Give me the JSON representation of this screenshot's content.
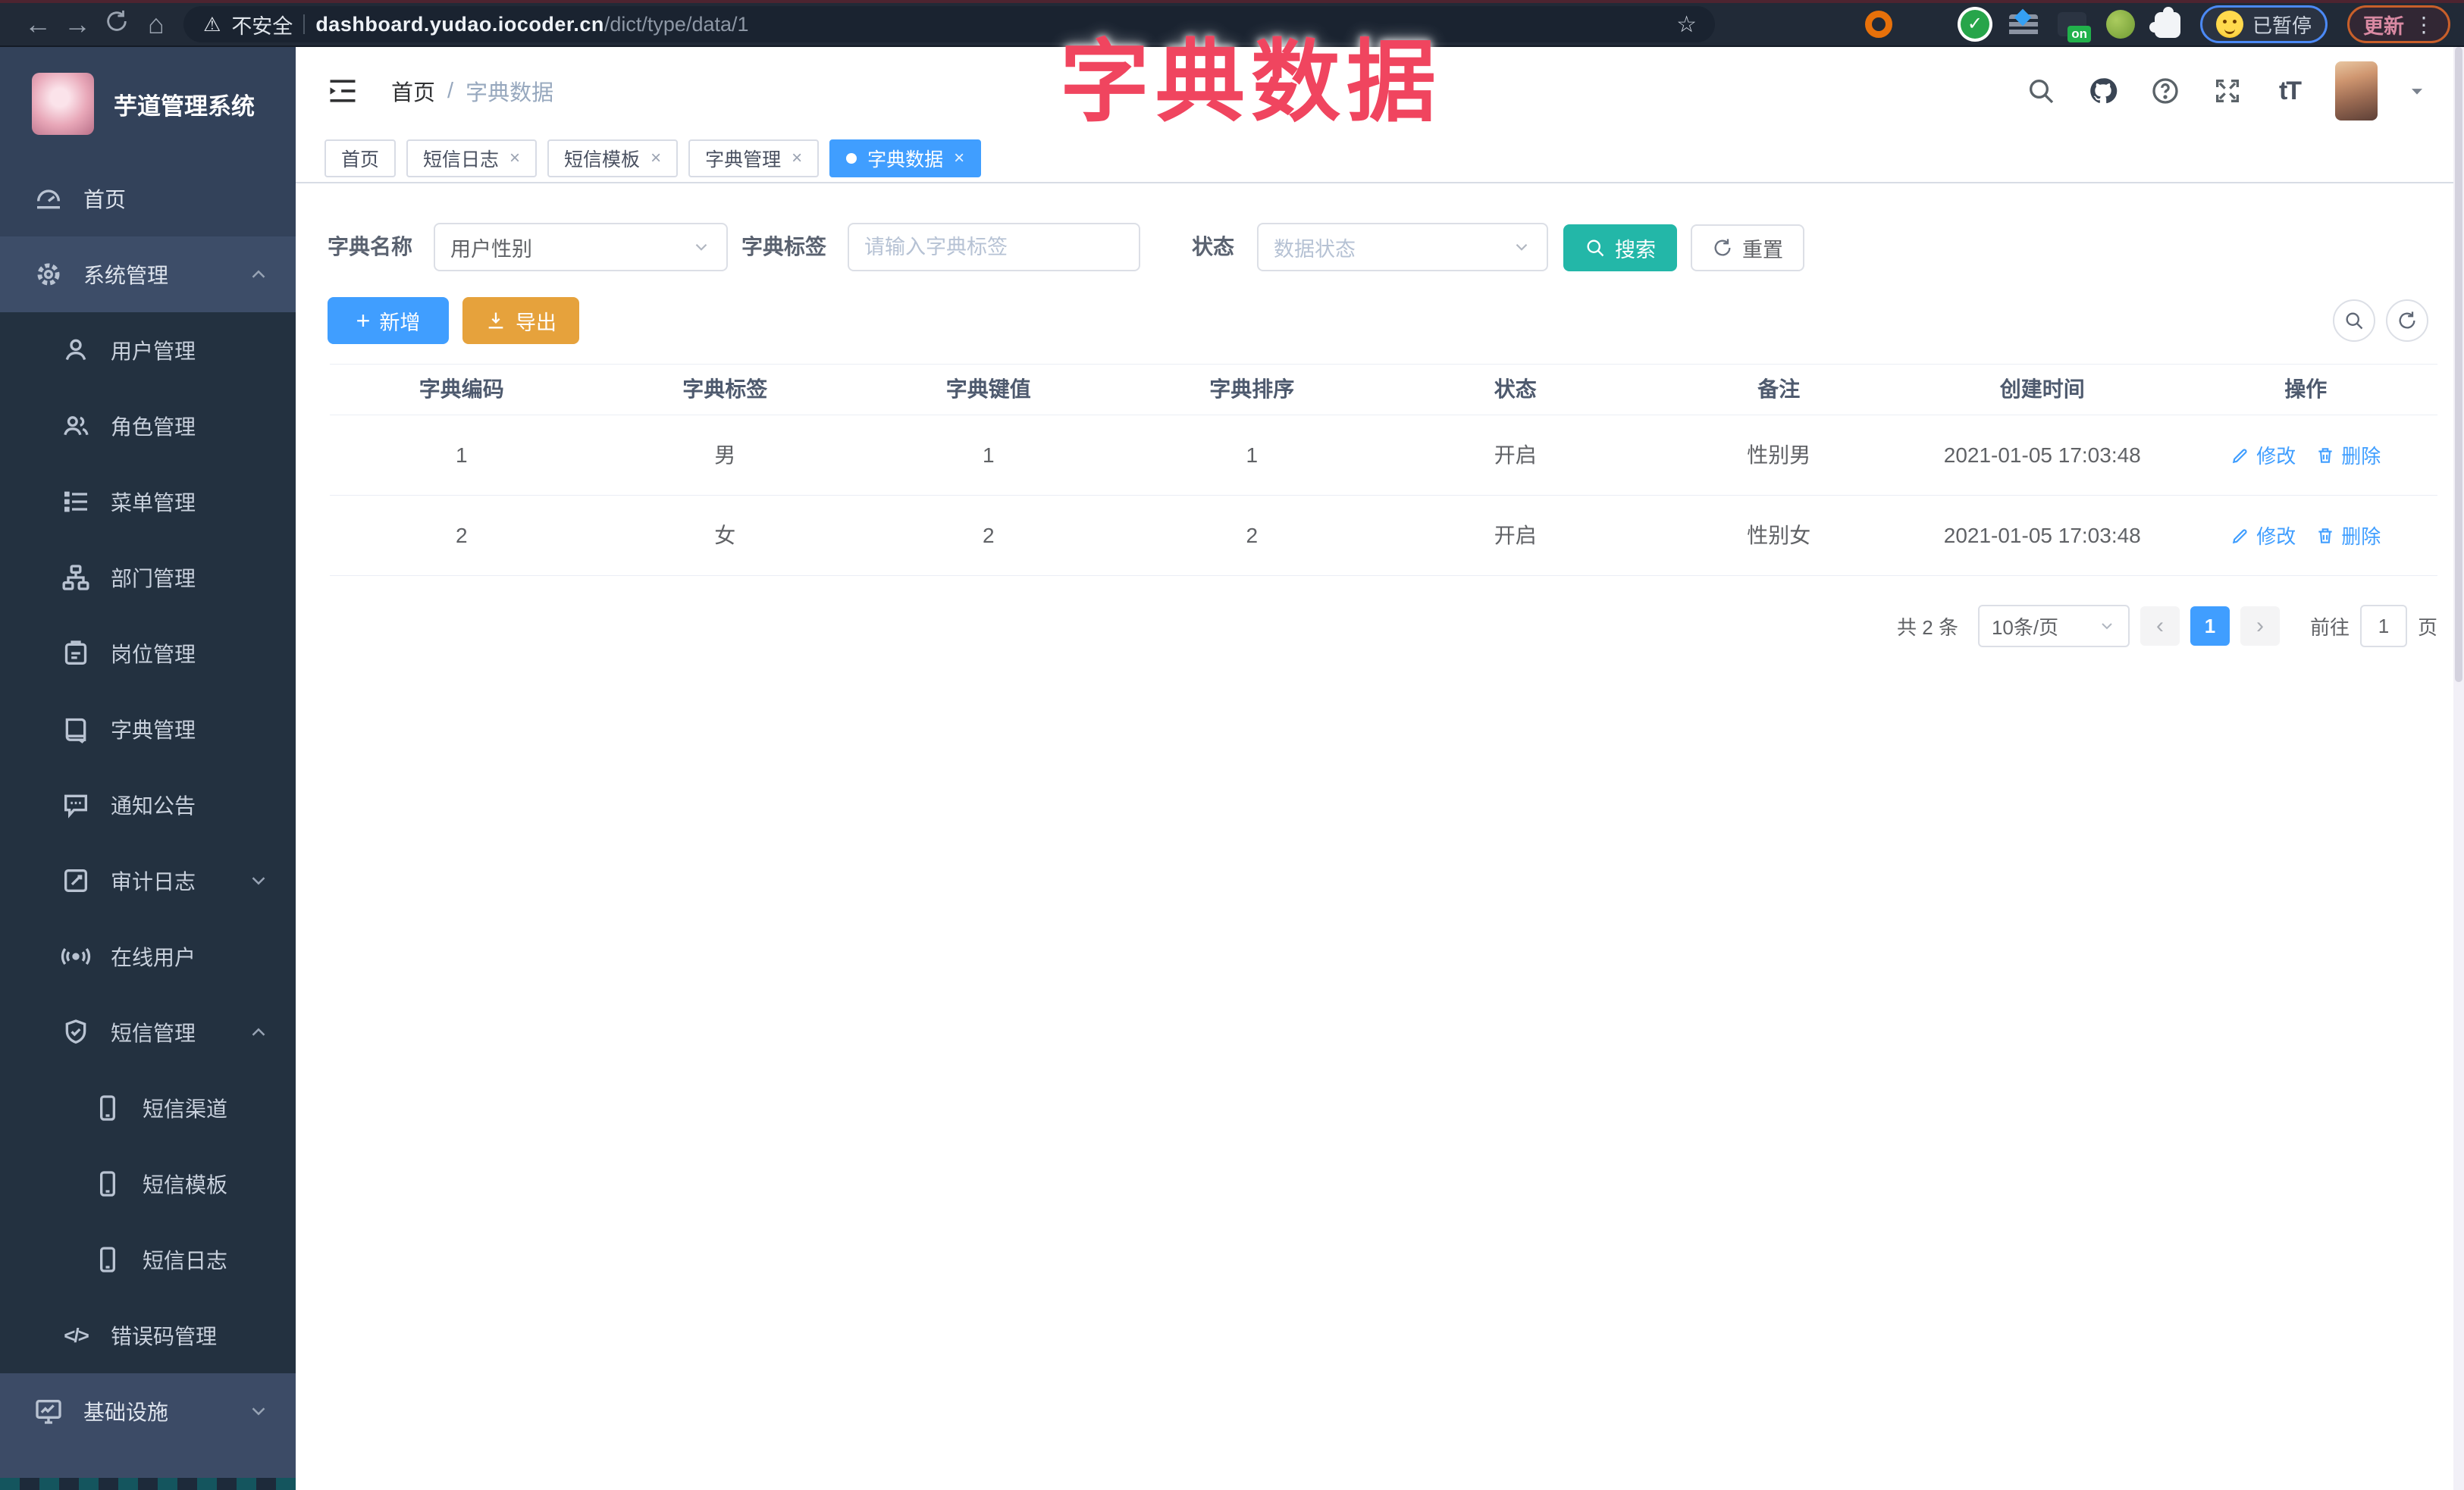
{
  "annotation": {
    "title": "字典数据"
  },
  "browser": {
    "back": "←",
    "forward": "→",
    "home_icon": "⌂",
    "warning": "⚠",
    "not_secure": "不安全",
    "url_host": "dashboard.yudao.iocoder.cn",
    "url_path": "/dict/type/data/1",
    "star": "☆",
    "ext_check": "✓",
    "ext_on_badge": "on",
    "profile_status": "已暂停",
    "update_label": "更新",
    "kebab": "⋮"
  },
  "sidebar": {
    "app_title": "芋道管理系统",
    "code_glyph": "</>",
    "items": [
      {
        "label": "首页"
      },
      {
        "label": "系统管理"
      },
      {
        "label": "用户管理"
      },
      {
        "label": "角色管理"
      },
      {
        "label": "菜单管理"
      },
      {
        "label": "部门管理"
      },
      {
        "label": "岗位管理"
      },
      {
        "label": "字典管理"
      },
      {
        "label": "通知公告"
      },
      {
        "label": "审计日志"
      },
      {
        "label": "在线用户"
      },
      {
        "label": "短信管理"
      },
      {
        "label": "短信渠道"
      },
      {
        "label": "短信模板"
      },
      {
        "label": "短信日志"
      },
      {
        "label": "错误码管理"
      },
      {
        "label": "基础设施"
      }
    ]
  },
  "header": {
    "breadcrumb_home": "首页",
    "breadcrumb_sep": "/",
    "breadcrumb_current": "字典数据",
    "font_icon": "tT"
  },
  "tabs": {
    "close": "×",
    "items": [
      {
        "label": "首页"
      },
      {
        "label": "短信日志"
      },
      {
        "label": "短信模板"
      },
      {
        "label": "字典管理"
      },
      {
        "label": "字典数据"
      }
    ]
  },
  "filters": {
    "name_label": "字典名称",
    "name_value": "用户性别",
    "tag_label": "字典标签",
    "tag_placeholder": "请输入字典标签",
    "status_label": "状态",
    "status_placeholder": "数据状态",
    "search_label": "搜索",
    "reset_label": "重置"
  },
  "toolbar": {
    "add_label": "新增",
    "export_label": "导出",
    "plus": "+"
  },
  "table": {
    "columns": [
      "字典编码",
      "字典标签",
      "字典键值",
      "字典排序",
      "状态",
      "备注",
      "创建时间",
      "操作"
    ],
    "rows": [
      {
        "code": "1",
        "label": "男",
        "value": "1",
        "sort": "1",
        "status": "开启",
        "remark": "性别男",
        "created": "2021-01-05 17:03:48",
        "edit": "修改",
        "del": "删除"
      },
      {
        "code": "2",
        "label": "女",
        "value": "2",
        "sort": "2",
        "status": "开启",
        "remark": "性别女",
        "created": "2021-01-05 17:03:48",
        "edit": "修改",
        "del": "删除"
      }
    ]
  },
  "pagination": {
    "total": "共 2 条",
    "page_size": "10条/页",
    "prev": "‹",
    "page": "1",
    "next": "›",
    "goto_label": "前往",
    "goto_value": "1",
    "unit": "页"
  },
  "colors": {
    "primary": "#409eff",
    "teal": "#23b7a8",
    "warning": "#e6a23c",
    "annotation": "#f0455f",
    "sidebar": "#33425a",
    "submenu": "#233140"
  }
}
